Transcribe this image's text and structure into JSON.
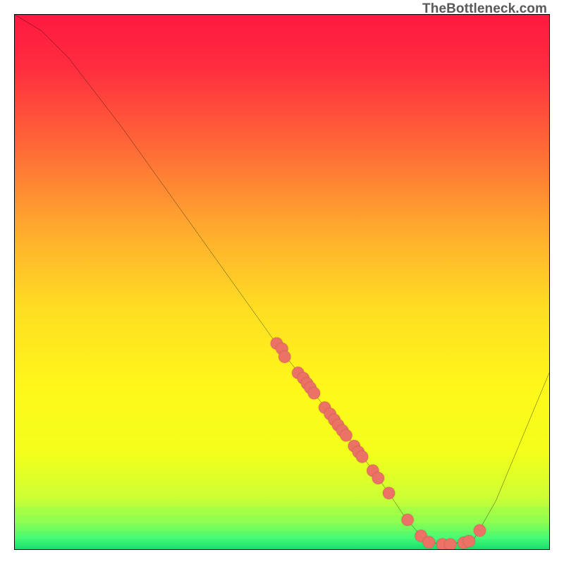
{
  "watermark": {
    "text": "TheBottleneck.com"
  },
  "chart_data": {
    "type": "line",
    "title": "",
    "xlabel": "",
    "ylabel": "",
    "xlim": [
      0,
      100
    ],
    "ylim": [
      0,
      100
    ],
    "curve": [
      {
        "x": 0,
        "y": 100
      },
      {
        "x": 5,
        "y": 97
      },
      {
        "x": 10,
        "y": 92
      },
      {
        "x": 15,
        "y": 85.5
      },
      {
        "x": 20,
        "y": 79
      },
      {
        "x": 25,
        "y": 72
      },
      {
        "x": 30,
        "y": 65
      },
      {
        "x": 35,
        "y": 58
      },
      {
        "x": 40,
        "y": 51
      },
      {
        "x": 45,
        "y": 44
      },
      {
        "x": 50,
        "y": 37
      },
      {
        "x": 55,
        "y": 30.5
      },
      {
        "x": 60,
        "y": 24
      },
      {
        "x": 65,
        "y": 17.5
      },
      {
        "x": 70,
        "y": 10.5
      },
      {
        "x": 73,
        "y": 6
      },
      {
        "x": 76,
        "y": 2.5
      },
      {
        "x": 79,
        "y": 1
      },
      {
        "x": 82,
        "y": 1
      },
      {
        "x": 86,
        "y": 2
      },
      {
        "x": 90,
        "y": 9
      },
      {
        "x": 95,
        "y": 21
      },
      {
        "x": 100,
        "y": 33
      }
    ],
    "scatter": [
      {
        "x": 49,
        "y": 38.5
      },
      {
        "x": 50,
        "y": 37.5
      },
      {
        "x": 50.5,
        "y": 36
      },
      {
        "x": 53,
        "y": 33
      },
      {
        "x": 54,
        "y": 32
      },
      {
        "x": 54.7,
        "y": 31
      },
      {
        "x": 55.3,
        "y": 30.2
      },
      {
        "x": 56,
        "y": 29.2
      },
      {
        "x": 58,
        "y": 26.5
      },
      {
        "x": 59,
        "y": 25.3
      },
      {
        "x": 59.8,
        "y": 24.2
      },
      {
        "x": 60.5,
        "y": 23.2
      },
      {
        "x": 61.3,
        "y": 22.2
      },
      {
        "x": 62,
        "y": 21.3
      },
      {
        "x": 63.5,
        "y": 19.3
      },
      {
        "x": 64.3,
        "y": 18.2
      },
      {
        "x": 65,
        "y": 17.3
      },
      {
        "x": 67,
        "y": 14.7
      },
      {
        "x": 68,
        "y": 13.3
      },
      {
        "x": 70,
        "y": 10.5
      },
      {
        "x": 73.5,
        "y": 5.5
      },
      {
        "x": 76,
        "y": 2.5
      },
      {
        "x": 77.5,
        "y": 1.3
      },
      {
        "x": 80,
        "y": 0.9
      },
      {
        "x": 81.5,
        "y": 0.9
      },
      {
        "x": 84,
        "y": 1.2
      },
      {
        "x": 85,
        "y": 1.5
      },
      {
        "x": 87,
        "y": 3.5
      }
    ]
  }
}
